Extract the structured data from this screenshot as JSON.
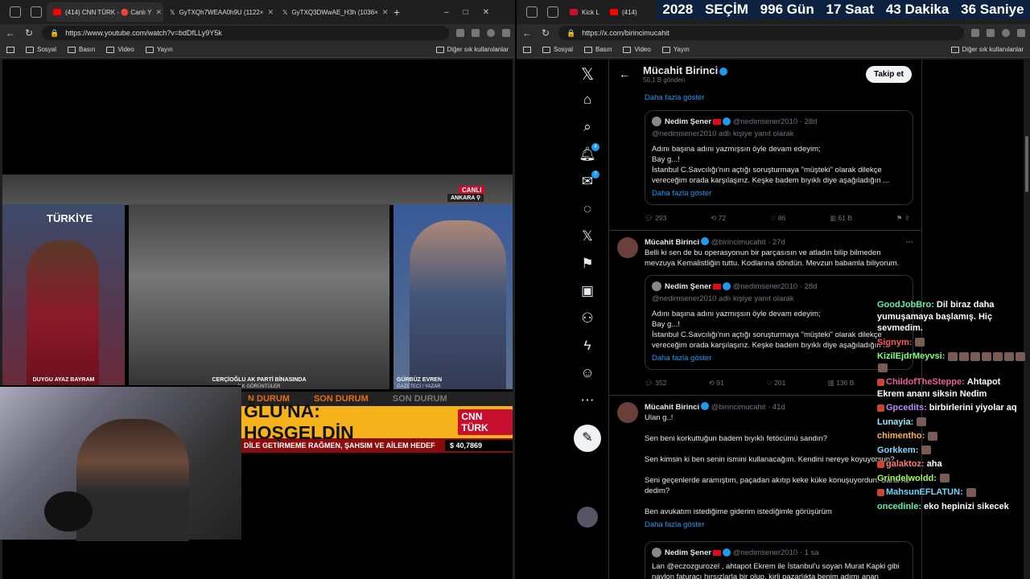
{
  "left_browser": {
    "tabs": [
      {
        "label": "(414) CNN TÜRK - 🔴 Canlı Y",
        "active": true,
        "fav": "#ff0000"
      },
      {
        "label": "GyTXQh7WEAA0h9U (1122×",
        "active": false,
        "fav": "#fff"
      },
      {
        "label": "GyTXQ3DWwAE_H3h (1036×",
        "active": false,
        "fav": "#fff"
      }
    ],
    "url": "https://www.youtube.com/watch?v=bdDfLLy9Y5k",
    "bookmarks": [
      "Sosyal",
      "Basın",
      "Video",
      "Yayın"
    ],
    "bookmarks_right": "Diğer sık kullanılanlar"
  },
  "right_browser": {
    "tabs": [
      {
        "label": "Kick L",
        "fav": "#53fc18"
      },
      {
        "label": "(414)",
        "fav": "#ff0000"
      }
    ],
    "url": "https://x.com/birincimucahit",
    "bookmarks": [
      "Sosyal",
      "Basın",
      "Video",
      "Yayın"
    ],
    "bookmarks_right": "Diğer sık kullanılanlar"
  },
  "countdown": {
    "year": "2028",
    "word": "SEÇİM",
    "days": "996 Gün",
    "hours": "17 Saat",
    "minutes": "43 Dakika",
    "seconds": "36 Saniye"
  },
  "video": {
    "live": "CANLI",
    "location": "ANKARA",
    "p1_caption": "DUYGU AYAZ BAYRAM",
    "p1_logo": "TÜRKİYE",
    "p2_caption": "CERÇİOĞLU AK PARTİ BİNASINDA",
    "p2_sub": "İLK GÖRÜNTÜLER",
    "p3_caption": "GÜRBÜZ EVREN",
    "p3_sub": "GAZETECİ / YAZAR",
    "son_durum": [
      "N DURUM",
      "SON DURUM",
      "SON DURUM"
    ],
    "headline": "ĞLU'NA: HOŞGELDİN",
    "channel": "CNN TÜRK",
    "ticker": "DİLE GETİRMEME RAĞMEN, ŞAHSIM VE AİLEM HEDEF",
    "currency": "$  40,7869"
  },
  "x": {
    "profile_name": "Mücahit Birinci",
    "profile_posts": "50,1 B gönderi",
    "follow": "Takip et",
    "nav_badges": {
      "notifications": "4",
      "messages": "7"
    },
    "top_more": "Daha fazla göster",
    "tweets": [
      {
        "name": "",
        "handle": "",
        "date": "",
        "text": "",
        "more": "",
        "quote": {
          "name": "Nedim Şener",
          "handle": "@nedimsener2010 · 28d",
          "reply": "@nedimsener2010 adlı kişiye yanıt olarak",
          "text": "Adını başına adını yazmışsın öyle devam edeyim;\nBay g...!\nİstanbul C.Savcılığı'nın açtığı soruşturmaya \"müşteki\" olarak dilekçe vereceğim orada karşılaşırız. Keşke badem bıyıklı diye aşağıladığın ...",
          "more": "Daha fazla göster"
        },
        "stats": {
          "replies": "293",
          "reposts": "72",
          "likes": "86",
          "views": "61 B"
        }
      },
      {
        "name": "Mücahit Birinci",
        "handle": "@birincimucahit · 27d",
        "text": "Belli ki sen de bu operasyonun bir parçasısın ve atladın bilip bilmeden mevzuya Kemalistliğin tuttu. Kodlarına döndün. Mevzun babamla biliyorum.",
        "more": "",
        "quote": {
          "name": "Nedim Şener",
          "handle": "@nedimsener2010 · 28d",
          "reply": "@nedimsener2010 adlı kişiye yanıt olarak",
          "text": "Adını başına adını yazmışsın öyle devam edeyim;\nBay g...!\nİstanbul C.Savcılığı'nın açtığı soruşturmaya \"müşteki\" olarak dilekçe vereceğim orada karşılaşırız. Keşke badem bıyıklı diye aşağıladığın ...",
          "more": "Daha fazla göster"
        },
        "stats": {
          "replies": "352",
          "reposts": "91",
          "likes": "201",
          "views": "136 B"
        }
      },
      {
        "name": "Mücahit Birinci",
        "handle": "@birincimucahit · 41d",
        "text": "Ulan g..!\n\nSen beni korkuttuğun badem bıyıklı fetöcümü sandın?\n\nSen kimsin ki ben senin ismini kullanacağım. Kendini nereye koyuyorsun?\n\nSeni geçenlerde aramıştım, paçadan akıtıp keke küke konuşuyordun. Sana ne dedim?\n\nBen avukatım istediğime giderim istediğimle görüşürüm",
        "more": "Daha fazla göster",
        "quote": {
          "name": "Nedim Şener",
          "handle": "@nedimsener2010 · 1 sa",
          "reply": "",
          "text": "Lan @eczozgurozel , ahtapot Ekrem ile İstanbul'u soyan Murat Kapki gibi navlon faturacı hırsızlarla bir olup, kirli pazarlıkta benim adımı anan",
          "more": ""
        },
        "stats": null
      }
    ]
  },
  "chat": [
    {
      "user": "GoodJobBro:",
      "color": "#5ef3a8",
      "msg": "Dil biraz daha yumuşamaya başlamış. Hiç sevmedim.",
      "badge": false,
      "emotes": 0
    },
    {
      "user": "Signym:",
      "color": "#ff5a5a",
      "msg": "",
      "badge": false,
      "emotes": 1
    },
    {
      "user": "KizilEjdrMeyvsi:",
      "color": "#7fff7f",
      "msg": "",
      "badge": false,
      "emotes": 8
    },
    {
      "user": "ChildofTheSteppe:",
      "color": "#e85c9b",
      "msg": "Ahtapot Ekrem ananı siksin Nedim",
      "badge": true,
      "emotes": 0
    },
    {
      "user": "Gpcedits:",
      "color": "#bb86fc",
      "msg": "birbirlerini yiyolar aq",
      "badge": true,
      "emotes": 0
    },
    {
      "user": "Lunayia:",
      "color": "#9be7ff",
      "msg": "",
      "badge": false,
      "emotes": 1
    },
    {
      "user": "chimentho:",
      "color": "#ffb347",
      "msg": "",
      "badge": false,
      "emotes": 1
    },
    {
      "user": "Gorkkem:",
      "color": "#80d8ff",
      "msg": "",
      "badge": false,
      "emotes": 1
    },
    {
      "user": "galaktoz:",
      "color": "#ff7a7a",
      "msg": "aha",
      "badge": true,
      "emotes": 0
    },
    {
      "user": "Grindelwoldd:",
      "color": "#9cff57",
      "msg": "",
      "badge": false,
      "emotes": 1
    },
    {
      "user": "MahsunEFLATUN:",
      "color": "#66d9ff",
      "msg": "",
      "badge": true,
      "emotes": 1
    },
    {
      "user": "oncedinle:",
      "color": "#5ef3a8",
      "msg": "eko hepinizi sikecek",
      "badge": false,
      "emotes": 0
    }
  ]
}
